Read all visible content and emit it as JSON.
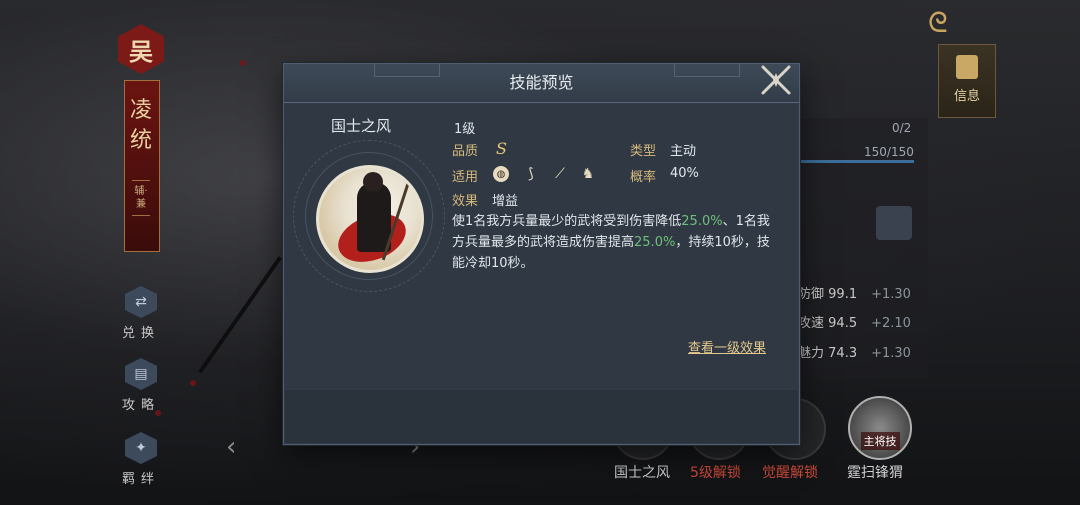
{
  "dialog": {
    "title": "技能预览",
    "skill_name": "国士之风",
    "level": "1级",
    "quality_label": "品质",
    "quality_value": "S",
    "type_label": "类型",
    "type_value": "主动",
    "units_label": "适用",
    "units": [
      "shield-icon",
      "bow-icon",
      "spear-icon",
      "horse-icon"
    ],
    "chance_label": "概率",
    "chance_value": "40%",
    "effect_label": "效果",
    "effect_value": "增益",
    "description": {
      "p1": "使1名我方兵量最少的武将受到伤害降低",
      "h1": "25.0%",
      "p2": "、1名我方兵量最多的武将造成伤害提高",
      "h2": "25.0%",
      "p3": "，持续10秒，技能冷却10秒。"
    },
    "view_link": "查看一级效果"
  },
  "left": {
    "faction": "吴",
    "hero_name": "凌统",
    "role": "辅·兼",
    "buttons": [
      {
        "label": "兑换",
        "icon": "exchange-icon"
      },
      {
        "label": "攻略",
        "icon": "guide-icon"
      },
      {
        "label": "羁绊",
        "icon": "bond-icon"
      }
    ]
  },
  "right": {
    "info_tab": "信息",
    "count": "0/2",
    "hp": "150/150",
    "stats": [
      {
        "name": "防御",
        "value": "99.1",
        "bonus": "+1.30"
      },
      {
        "name": "攻速",
        "value": "94.5",
        "bonus": "+2.10"
      },
      {
        "name": "魅力",
        "value": "74.3",
        "bonus": "+1.30"
      }
    ],
    "skills": [
      {
        "label": "国士之风",
        "color": "#cfcfcf"
      },
      {
        "label": "5级解锁",
        "color": "#d04a3a"
      },
      {
        "label": "觉醒解锁",
        "color": "#d04a3a"
      },
      {
        "label": "霆扫锋猬",
        "color": "#cfcfcf"
      }
    ],
    "main_skill_badge": "主将技"
  }
}
